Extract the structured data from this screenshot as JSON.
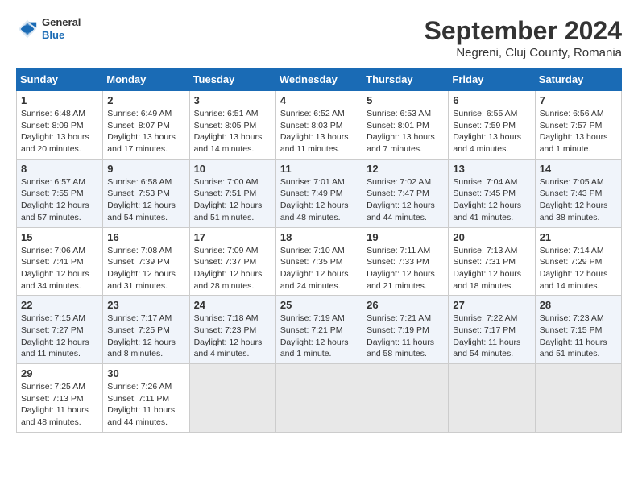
{
  "header": {
    "logo": {
      "general": "General",
      "blue": "Blue"
    },
    "title": "September 2024",
    "subtitle": "Negreni, Cluj County, Romania"
  },
  "calendar": {
    "headers": [
      "Sunday",
      "Monday",
      "Tuesday",
      "Wednesday",
      "Thursday",
      "Friday",
      "Saturday"
    ],
    "weeks": [
      [
        {
          "day": "",
          "empty": true
        },
        {
          "day": "",
          "empty": true
        },
        {
          "day": "",
          "empty": true
        },
        {
          "day": "",
          "empty": true
        },
        {
          "day": "",
          "empty": true
        },
        {
          "day": "",
          "empty": true
        },
        {
          "day": "",
          "empty": true
        }
      ],
      [
        {
          "day": "1",
          "sunrise": "Sunrise: 6:48 AM",
          "sunset": "Sunset: 8:09 PM",
          "daylight": "Daylight: 13 hours and 20 minutes."
        },
        {
          "day": "2",
          "sunrise": "Sunrise: 6:49 AM",
          "sunset": "Sunset: 8:07 PM",
          "daylight": "Daylight: 13 hours and 17 minutes."
        },
        {
          "day": "3",
          "sunrise": "Sunrise: 6:51 AM",
          "sunset": "Sunset: 8:05 PM",
          "daylight": "Daylight: 13 hours and 14 minutes."
        },
        {
          "day": "4",
          "sunrise": "Sunrise: 6:52 AM",
          "sunset": "Sunset: 8:03 PM",
          "daylight": "Daylight: 13 hours and 11 minutes."
        },
        {
          "day": "5",
          "sunrise": "Sunrise: 6:53 AM",
          "sunset": "Sunset: 8:01 PM",
          "daylight": "Daylight: 13 hours and 7 minutes."
        },
        {
          "day": "6",
          "sunrise": "Sunrise: 6:55 AM",
          "sunset": "Sunset: 7:59 PM",
          "daylight": "Daylight: 13 hours and 4 minutes."
        },
        {
          "day": "7",
          "sunrise": "Sunrise: 6:56 AM",
          "sunset": "Sunset: 7:57 PM",
          "daylight": "Daylight: 13 hours and 1 minute."
        }
      ],
      [
        {
          "day": "8",
          "sunrise": "Sunrise: 6:57 AM",
          "sunset": "Sunset: 7:55 PM",
          "daylight": "Daylight: 12 hours and 57 minutes."
        },
        {
          "day": "9",
          "sunrise": "Sunrise: 6:58 AM",
          "sunset": "Sunset: 7:53 PM",
          "daylight": "Daylight: 12 hours and 54 minutes."
        },
        {
          "day": "10",
          "sunrise": "Sunrise: 7:00 AM",
          "sunset": "Sunset: 7:51 PM",
          "daylight": "Daylight: 12 hours and 51 minutes."
        },
        {
          "day": "11",
          "sunrise": "Sunrise: 7:01 AM",
          "sunset": "Sunset: 7:49 PM",
          "daylight": "Daylight: 12 hours and 48 minutes."
        },
        {
          "day": "12",
          "sunrise": "Sunrise: 7:02 AM",
          "sunset": "Sunset: 7:47 PM",
          "daylight": "Daylight: 12 hours and 44 minutes."
        },
        {
          "day": "13",
          "sunrise": "Sunrise: 7:04 AM",
          "sunset": "Sunset: 7:45 PM",
          "daylight": "Daylight: 12 hours and 41 minutes."
        },
        {
          "day": "14",
          "sunrise": "Sunrise: 7:05 AM",
          "sunset": "Sunset: 7:43 PM",
          "daylight": "Daylight: 12 hours and 38 minutes."
        }
      ],
      [
        {
          "day": "15",
          "sunrise": "Sunrise: 7:06 AM",
          "sunset": "Sunset: 7:41 PM",
          "daylight": "Daylight: 12 hours and 34 minutes."
        },
        {
          "day": "16",
          "sunrise": "Sunrise: 7:08 AM",
          "sunset": "Sunset: 7:39 PM",
          "daylight": "Daylight: 12 hours and 31 minutes."
        },
        {
          "day": "17",
          "sunrise": "Sunrise: 7:09 AM",
          "sunset": "Sunset: 7:37 PM",
          "daylight": "Daylight: 12 hours and 28 minutes."
        },
        {
          "day": "18",
          "sunrise": "Sunrise: 7:10 AM",
          "sunset": "Sunset: 7:35 PM",
          "daylight": "Daylight: 12 hours and 24 minutes."
        },
        {
          "day": "19",
          "sunrise": "Sunrise: 7:11 AM",
          "sunset": "Sunset: 7:33 PM",
          "daylight": "Daylight: 12 hours and 21 minutes."
        },
        {
          "day": "20",
          "sunrise": "Sunrise: 7:13 AM",
          "sunset": "Sunset: 7:31 PM",
          "daylight": "Daylight: 12 hours and 18 minutes."
        },
        {
          "day": "21",
          "sunrise": "Sunrise: 7:14 AM",
          "sunset": "Sunset: 7:29 PM",
          "daylight": "Daylight: 12 hours and 14 minutes."
        }
      ],
      [
        {
          "day": "22",
          "sunrise": "Sunrise: 7:15 AM",
          "sunset": "Sunset: 7:27 PM",
          "daylight": "Daylight: 12 hours and 11 minutes."
        },
        {
          "day": "23",
          "sunrise": "Sunrise: 7:17 AM",
          "sunset": "Sunset: 7:25 PM",
          "daylight": "Daylight: 12 hours and 8 minutes."
        },
        {
          "day": "24",
          "sunrise": "Sunrise: 7:18 AM",
          "sunset": "Sunset: 7:23 PM",
          "daylight": "Daylight: 12 hours and 4 minutes."
        },
        {
          "day": "25",
          "sunrise": "Sunrise: 7:19 AM",
          "sunset": "Sunset: 7:21 PM",
          "daylight": "Daylight: 12 hours and 1 minute."
        },
        {
          "day": "26",
          "sunrise": "Sunrise: 7:21 AM",
          "sunset": "Sunset: 7:19 PM",
          "daylight": "Daylight: 11 hours and 58 minutes."
        },
        {
          "day": "27",
          "sunrise": "Sunrise: 7:22 AM",
          "sunset": "Sunset: 7:17 PM",
          "daylight": "Daylight: 11 hours and 54 minutes."
        },
        {
          "day": "28",
          "sunrise": "Sunrise: 7:23 AM",
          "sunset": "Sunset: 7:15 PM",
          "daylight": "Daylight: 11 hours and 51 minutes."
        }
      ],
      [
        {
          "day": "29",
          "sunrise": "Sunrise: 7:25 AM",
          "sunset": "Sunset: 7:13 PM",
          "daylight": "Daylight: 11 hours and 48 minutes."
        },
        {
          "day": "30",
          "sunrise": "Sunrise: 7:26 AM",
          "sunset": "Sunset: 7:11 PM",
          "daylight": "Daylight: 11 hours and 44 minutes."
        },
        {
          "day": "",
          "empty": true
        },
        {
          "day": "",
          "empty": true
        },
        {
          "day": "",
          "empty": true
        },
        {
          "day": "",
          "empty": true
        },
        {
          "day": "",
          "empty": true
        }
      ]
    ]
  }
}
